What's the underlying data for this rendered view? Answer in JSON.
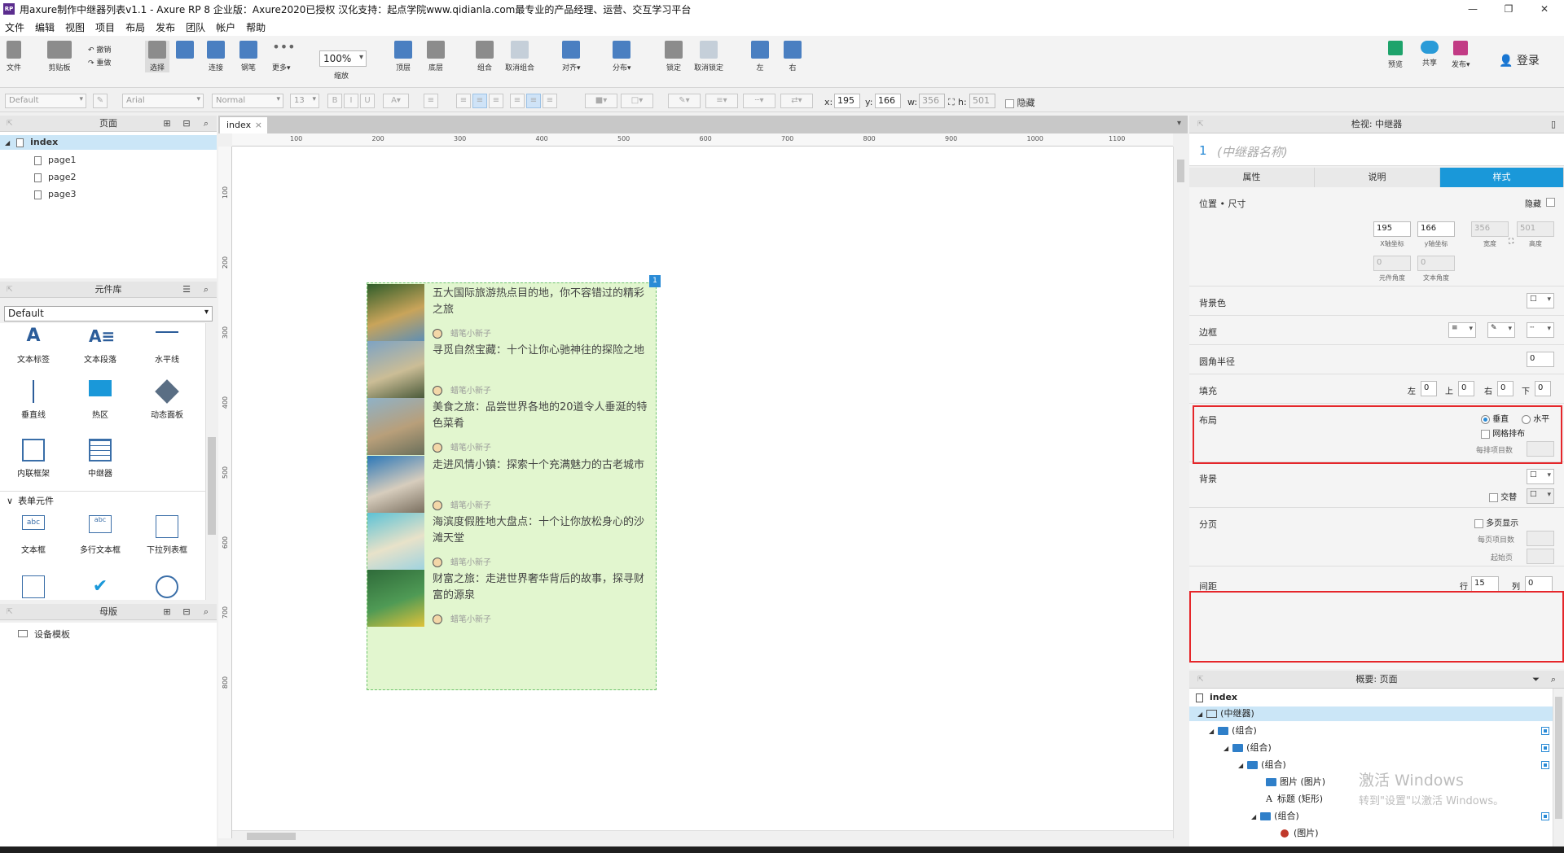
{
  "window": {
    "title": "用axure制作中继器列表v1.1 - Axure RP 8 企业版：Axure2020已授权 汉化支持：起点学院www.qidianla.com最专业的产品经理、运营、交互学习平台",
    "logo_text": "RP",
    "min": "—",
    "max": "❐",
    "close": "✕"
  },
  "menu": [
    "文件",
    "编辑",
    "视图",
    "项目",
    "布局",
    "发布",
    "团队",
    "帐户",
    "帮助"
  ],
  "toolbar": {
    "file": "文件",
    "clipboard": "剪贴板",
    "undo": "撤销",
    "redo": "重做",
    "select": "选择",
    "connect": "连接",
    "pen": "钢笔",
    "more": "更多▾",
    "zoom_value": "100%",
    "zoom": "缩放",
    "top": "顶层",
    "bottom": "底层",
    "group": "组合",
    "ungroup": "取消组合",
    "align": "对齐▾",
    "distribute": "分布▾",
    "lock": "锁定",
    "unlock": "取消锁定",
    "left": "左",
    "right": "右",
    "preview": "预览",
    "share": "共享",
    "publish": "发布▾",
    "login": "登录"
  },
  "format": {
    "style": "Default",
    "font": "Arial",
    "weight": "Normal",
    "size": "13",
    "bold": "B",
    "italic": "I",
    "underline": "U",
    "x_label": "x:",
    "x": "195",
    "y_label": "y:",
    "y": "166",
    "w_label": "w:",
    "w": "356",
    "h_label": "h:",
    "h": "501",
    "hide": "隐藏"
  },
  "pages_panel": {
    "title": "页面",
    "items": [
      "index",
      "page1",
      "page2",
      "page3"
    ]
  },
  "library_panel": {
    "title": "元件库",
    "selected": "Default",
    "widgets": [
      "文本标签",
      "文本段落",
      "水平线",
      "垂直线",
      "热区",
      "动态面板",
      "内联框架",
      "中继器"
    ],
    "form_section": "表单元件",
    "form_widgets": [
      "文本框",
      "多行文本框",
      "下拉列表框"
    ]
  },
  "masters_panel": {
    "title": "母版",
    "items": [
      "设备模板"
    ]
  },
  "canvas": {
    "tab": "index",
    "tab_close": "×",
    "ruler_top": [
      "100",
      "200",
      "300",
      "400",
      "500",
      "600",
      "700",
      "800",
      "900",
      "1000",
      "1100"
    ],
    "ruler_left": [
      "100",
      "200",
      "300",
      "400",
      "500",
      "600",
      "700",
      "800"
    ],
    "badge": "1",
    "items": [
      {
        "title": "五大国际旅游热点目的地，你不容错过的精彩之旅",
        "author": "蜡笔小新子",
        "colors": [
          "#2f5d2a",
          "#c9a45a",
          "#5f8fb4"
        ]
      },
      {
        "title": "寻觅自然宝藏：十个让你心驰神往的探险之地",
        "author": "蜡笔小新子",
        "colors": [
          "#7da3c4",
          "#cbbd96",
          "#4a5a3a"
        ]
      },
      {
        "title": "美食之旅：品尝世界各地的20道令人垂涎的特色菜肴",
        "author": "蜡笔小新子",
        "colors": [
          "#8fb2c7",
          "#b89f7a",
          "#6a6f5a"
        ]
      },
      {
        "title": "走进风情小镇：探索十个充满魅力的古老城市",
        "author": "蜡笔小新子",
        "colors": [
          "#2b77b8",
          "#d7cdbd",
          "#7a6f5f"
        ]
      },
      {
        "title": "海滨度假胜地大盘点：十个让你放松身心的沙滩天堂",
        "author": "蜡笔小新子",
        "colors": [
          "#5cc2d6",
          "#e8e2c9",
          "#9fd3df"
        ]
      },
      {
        "title": "财富之旅：走进世界奢华背后的故事，探寻财富的源泉",
        "author": "蜡笔小新子",
        "colors": [
          "#2f6b3a",
          "#4f9a55",
          "#e0c23a"
        ]
      }
    ]
  },
  "inspector": {
    "title": "检视: 中继器",
    "index": "1",
    "name_placeholder": "(中继器名称)",
    "tabs": [
      "属性",
      "说明",
      "样式"
    ],
    "pos_size": "位置 • 尺寸",
    "hide": "隐藏",
    "x": "195",
    "y": "166",
    "w": "356",
    "h": "501",
    "x_lab": "X轴坐标",
    "y_lab": "y轴坐标",
    "w_lab": "宽度",
    "h_lab": "高度",
    "rot": "0",
    "rot_lab": "元件角度",
    "trot": "0",
    "trot_lab": "文本角度",
    "bg_color": "背景色",
    "border": "边框",
    "radius": "圆角半径",
    "radius_val": "0",
    "fill": "填充",
    "pad_l": "左",
    "pad_l_v": "0",
    "pad_t": "上",
    "pad_t_v": "0",
    "pad_r": "右",
    "pad_r_v": "0",
    "pad_b": "下",
    "pad_b_v": "0",
    "layout": "布局",
    "vertical": "垂直",
    "horizontal": "水平",
    "grid": "网格排布",
    "per_row": "每排项目数",
    "background": "背景",
    "alternate": "交替",
    "paging": "分页",
    "multipage": "多页显示",
    "per_page": "每页项目数",
    "start_page": "起始页",
    "spacing": "间距",
    "row": "行",
    "row_v": "15",
    "col": "列",
    "col_v": "0"
  },
  "outline": {
    "title": "概要: 页面",
    "rows": [
      "index",
      "(中继器)",
      "(组合)",
      "(组合)",
      "(组合)",
      "图片 (图片)",
      "标题 (矩形)",
      "(组合)",
      "(图片)"
    ]
  },
  "watermark": {
    "line1": "激活 Windows",
    "line2": "转到\"设置\"以激活 Windows。"
  }
}
